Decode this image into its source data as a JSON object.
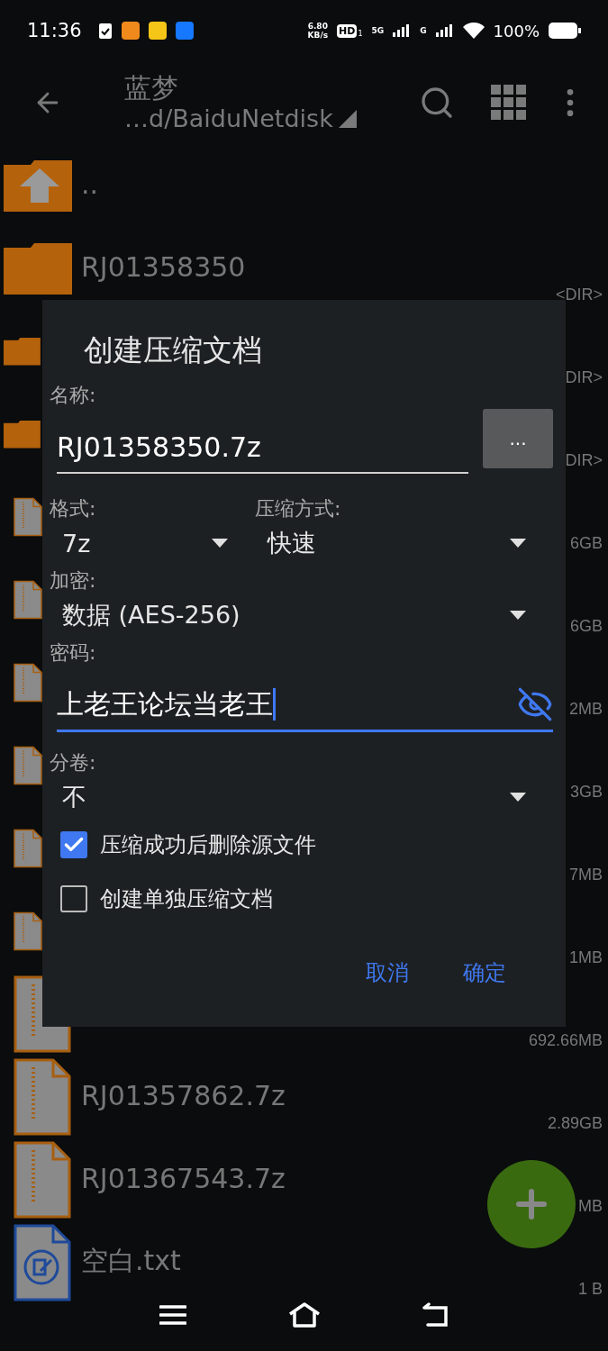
{
  "status_bar": {
    "time": "11:36",
    "net_speed": "6.80",
    "net_unit": "KB/s",
    "hd": "HD",
    "hd_sub": "1",
    "sim1": "5G",
    "sim2": "G",
    "battery": "100%"
  },
  "toolbar": {
    "title": "蓝梦",
    "path": "…d/BaiduNetdisk"
  },
  "files": [
    {
      "kind": "up",
      "name": ".."
    },
    {
      "kind": "folder",
      "name": "RJ01358350",
      "size": "<DIR>"
    },
    {
      "kind": "folder",
      "size": "DIR>"
    },
    {
      "kind": "folder",
      "size": "DIR>"
    },
    {
      "kind": "archive",
      "size": "6GB"
    },
    {
      "kind": "archive",
      "size": "6GB"
    },
    {
      "kind": "archive",
      "size": "2MB"
    },
    {
      "kind": "archive",
      "size": "3GB"
    },
    {
      "kind": "archive",
      "size": "7MB"
    },
    {
      "kind": "archive",
      "size": "1MB"
    },
    {
      "kind": "archive",
      "size": "692.66MB"
    },
    {
      "kind": "archive",
      "name": "RJ01357862.7z",
      "size": "2.89GB"
    },
    {
      "kind": "archive",
      "name": "RJ01367543.7z",
      "size": "MB"
    },
    {
      "kind": "text",
      "name": "空白.txt",
      "size": "1 B"
    }
  ],
  "dialog": {
    "title": "创建压缩文档",
    "name_label": "名称:",
    "name_value": "RJ01358350.7z",
    "browse_button": "...",
    "format_label": "格式:",
    "format_value": "7z",
    "method_label": "压缩方式:",
    "method_value": "快速",
    "encryption_label": "加密:",
    "encryption_value": "数据 (AES-256)",
    "password_label": "密码:",
    "password_value": "上老王论坛当老王",
    "password_visible": true,
    "split_label": "分卷:",
    "split_value": "不",
    "options": [
      {
        "label": "压缩成功后删除源文件",
        "checked": true
      },
      {
        "label": "创建单独压缩文档",
        "checked": false
      }
    ],
    "buttons": [
      "取消",
      "确定"
    ]
  }
}
